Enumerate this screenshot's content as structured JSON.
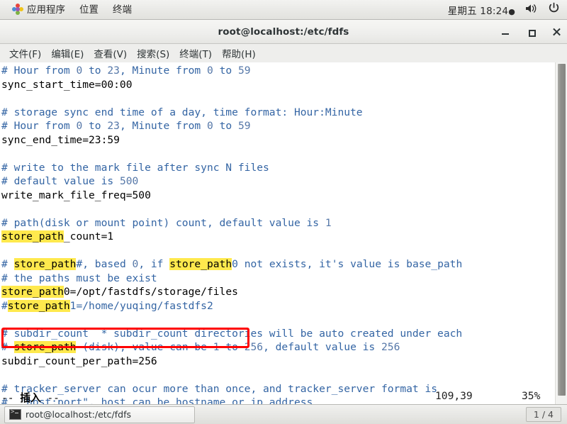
{
  "top_panel": {
    "applications_label": "应用程序",
    "places_label": "位置",
    "terminal_label": "终端",
    "clock": "星期五 18:24",
    "clock_dot": "●",
    "volume_icon": "volume-icon",
    "power_icon": "power-icon"
  },
  "window": {
    "title": "root@localhost:/etc/fdfs",
    "minimize": "–",
    "maximize": "□",
    "close": "✕",
    "menu": [
      "文件(F)",
      "编辑(E)",
      "查看(V)",
      "搜索(S)",
      "终端(T)",
      "帮助(H)"
    ]
  },
  "terminal": {
    "lines": [
      {
        "segments": [
          {
            "t": "# Hour from ",
            "c": "cmt"
          },
          {
            "t": "0",
            "c": "num"
          },
          {
            "t": " to ",
            "c": "cmt"
          },
          {
            "t": "23",
            "c": "num"
          },
          {
            "t": ", Minute from ",
            "c": "cmt"
          },
          {
            "t": "0",
            "c": "num"
          },
          {
            "t": " to ",
            "c": "cmt"
          },
          {
            "t": "59",
            "c": "num"
          }
        ]
      },
      {
        "segments": [
          {
            "t": "sync_start_time=00:00",
            "c": ""
          }
        ]
      },
      {
        "segments": [
          {
            "t": "",
            "c": ""
          }
        ]
      },
      {
        "segments": [
          {
            "t": "# storage sync end time of a day, time format: Hour:Minute",
            "c": "cmt"
          }
        ]
      },
      {
        "segments": [
          {
            "t": "# Hour from ",
            "c": "cmt"
          },
          {
            "t": "0",
            "c": "num"
          },
          {
            "t": " to ",
            "c": "cmt"
          },
          {
            "t": "23",
            "c": "num"
          },
          {
            "t": ", Minute from ",
            "c": "cmt"
          },
          {
            "t": "0",
            "c": "num"
          },
          {
            "t": " to ",
            "c": "cmt"
          },
          {
            "t": "59",
            "c": "num"
          }
        ]
      },
      {
        "segments": [
          {
            "t": "sync_end_time=23:59",
            "c": ""
          }
        ]
      },
      {
        "segments": [
          {
            "t": "",
            "c": ""
          }
        ]
      },
      {
        "segments": [
          {
            "t": "# write to the mark file after sync N files",
            "c": "cmt"
          }
        ]
      },
      {
        "segments": [
          {
            "t": "# default value is ",
            "c": "cmt"
          },
          {
            "t": "500",
            "c": "num"
          }
        ]
      },
      {
        "segments": [
          {
            "t": "write_mark_file_freq=500",
            "c": ""
          }
        ]
      },
      {
        "segments": [
          {
            "t": "",
            "c": ""
          }
        ]
      },
      {
        "segments": [
          {
            "t": "# path(disk or mount point) count, default value is ",
            "c": "cmt"
          },
          {
            "t": "1",
            "c": "num"
          }
        ]
      },
      {
        "segments": [
          {
            "t": "store_path",
            "c": "hl"
          },
          {
            "t": "_count=1",
            "c": ""
          }
        ]
      },
      {
        "segments": [
          {
            "t": "",
            "c": ""
          }
        ]
      },
      {
        "segments": [
          {
            "t": "# ",
            "c": "cmt"
          },
          {
            "t": "store_path",
            "c": "cmt hl"
          },
          {
            "t": "#, based ",
            "c": "cmt"
          },
          {
            "t": "0",
            "c": "num"
          },
          {
            "t": ", if ",
            "c": "cmt"
          },
          {
            "t": "store_path",
            "c": "cmt hl"
          },
          {
            "t": "0 not exists, it's value is base_path",
            "c": "cmt"
          }
        ]
      },
      {
        "segments": [
          {
            "t": "# the paths must be exist",
            "c": "cmt"
          }
        ]
      },
      {
        "segments": [
          {
            "t": "store_path",
            "c": "hl"
          },
          {
            "t": "0=/opt/fastdfs/storage/files",
            "c": ""
          }
        ]
      },
      {
        "segments": [
          {
            "t": "#",
            "c": "cmt"
          },
          {
            "t": "store_path",
            "c": "cmt hl"
          },
          {
            "t": "1=/home/yuqing/fastdfs2",
            "c": "cmt"
          }
        ]
      },
      {
        "segments": [
          {
            "t": "",
            "c": ""
          }
        ]
      },
      {
        "segments": [
          {
            "t": "# subdir_count  * subdir_count directories will be auto created under each",
            "c": "cmt"
          }
        ]
      },
      {
        "segments": [
          {
            "t": "# ",
            "c": "cmt"
          },
          {
            "t": "store_path",
            "c": "cmt hl"
          },
          {
            "t": " (disk), value can be ",
            "c": "cmt"
          },
          {
            "t": "1",
            "c": "num"
          },
          {
            "t": " to ",
            "c": "cmt"
          },
          {
            "t": "256",
            "c": "num"
          },
          {
            "t": ", default value is ",
            "c": "cmt"
          },
          {
            "t": "256",
            "c": "num"
          }
        ]
      },
      {
        "segments": [
          {
            "t": "subdir_count_per_path=256",
            "c": ""
          }
        ]
      },
      {
        "segments": [
          {
            "t": "",
            "c": ""
          }
        ]
      },
      {
        "segments": [
          {
            "t": "# tracker_server can ocur more than once, and tracker_server format is",
            "c": "cmt"
          }
        ]
      },
      {
        "segments": [
          {
            "t": "#  \"host:port\", host can be hostname or ip address",
            "c": "cmt"
          }
        ]
      }
    ],
    "status": {
      "mode_prefix": "-- ",
      "mode": "插入",
      "mode_suffix": " --",
      "position": "109,39",
      "percent": "35%"
    },
    "annotation": {
      "type": "red-rectangle",
      "color": "#ff0000",
      "target": "store_path0=/opt/fastdfs/storage/files"
    },
    "highlight_color": "#ffe94d",
    "comment_color": "#3465a4"
  },
  "bottom_panel": {
    "task_label": "root@localhost:/etc/fdfs",
    "task_icon": "terminal-icon",
    "workspace": "1 / 4"
  }
}
